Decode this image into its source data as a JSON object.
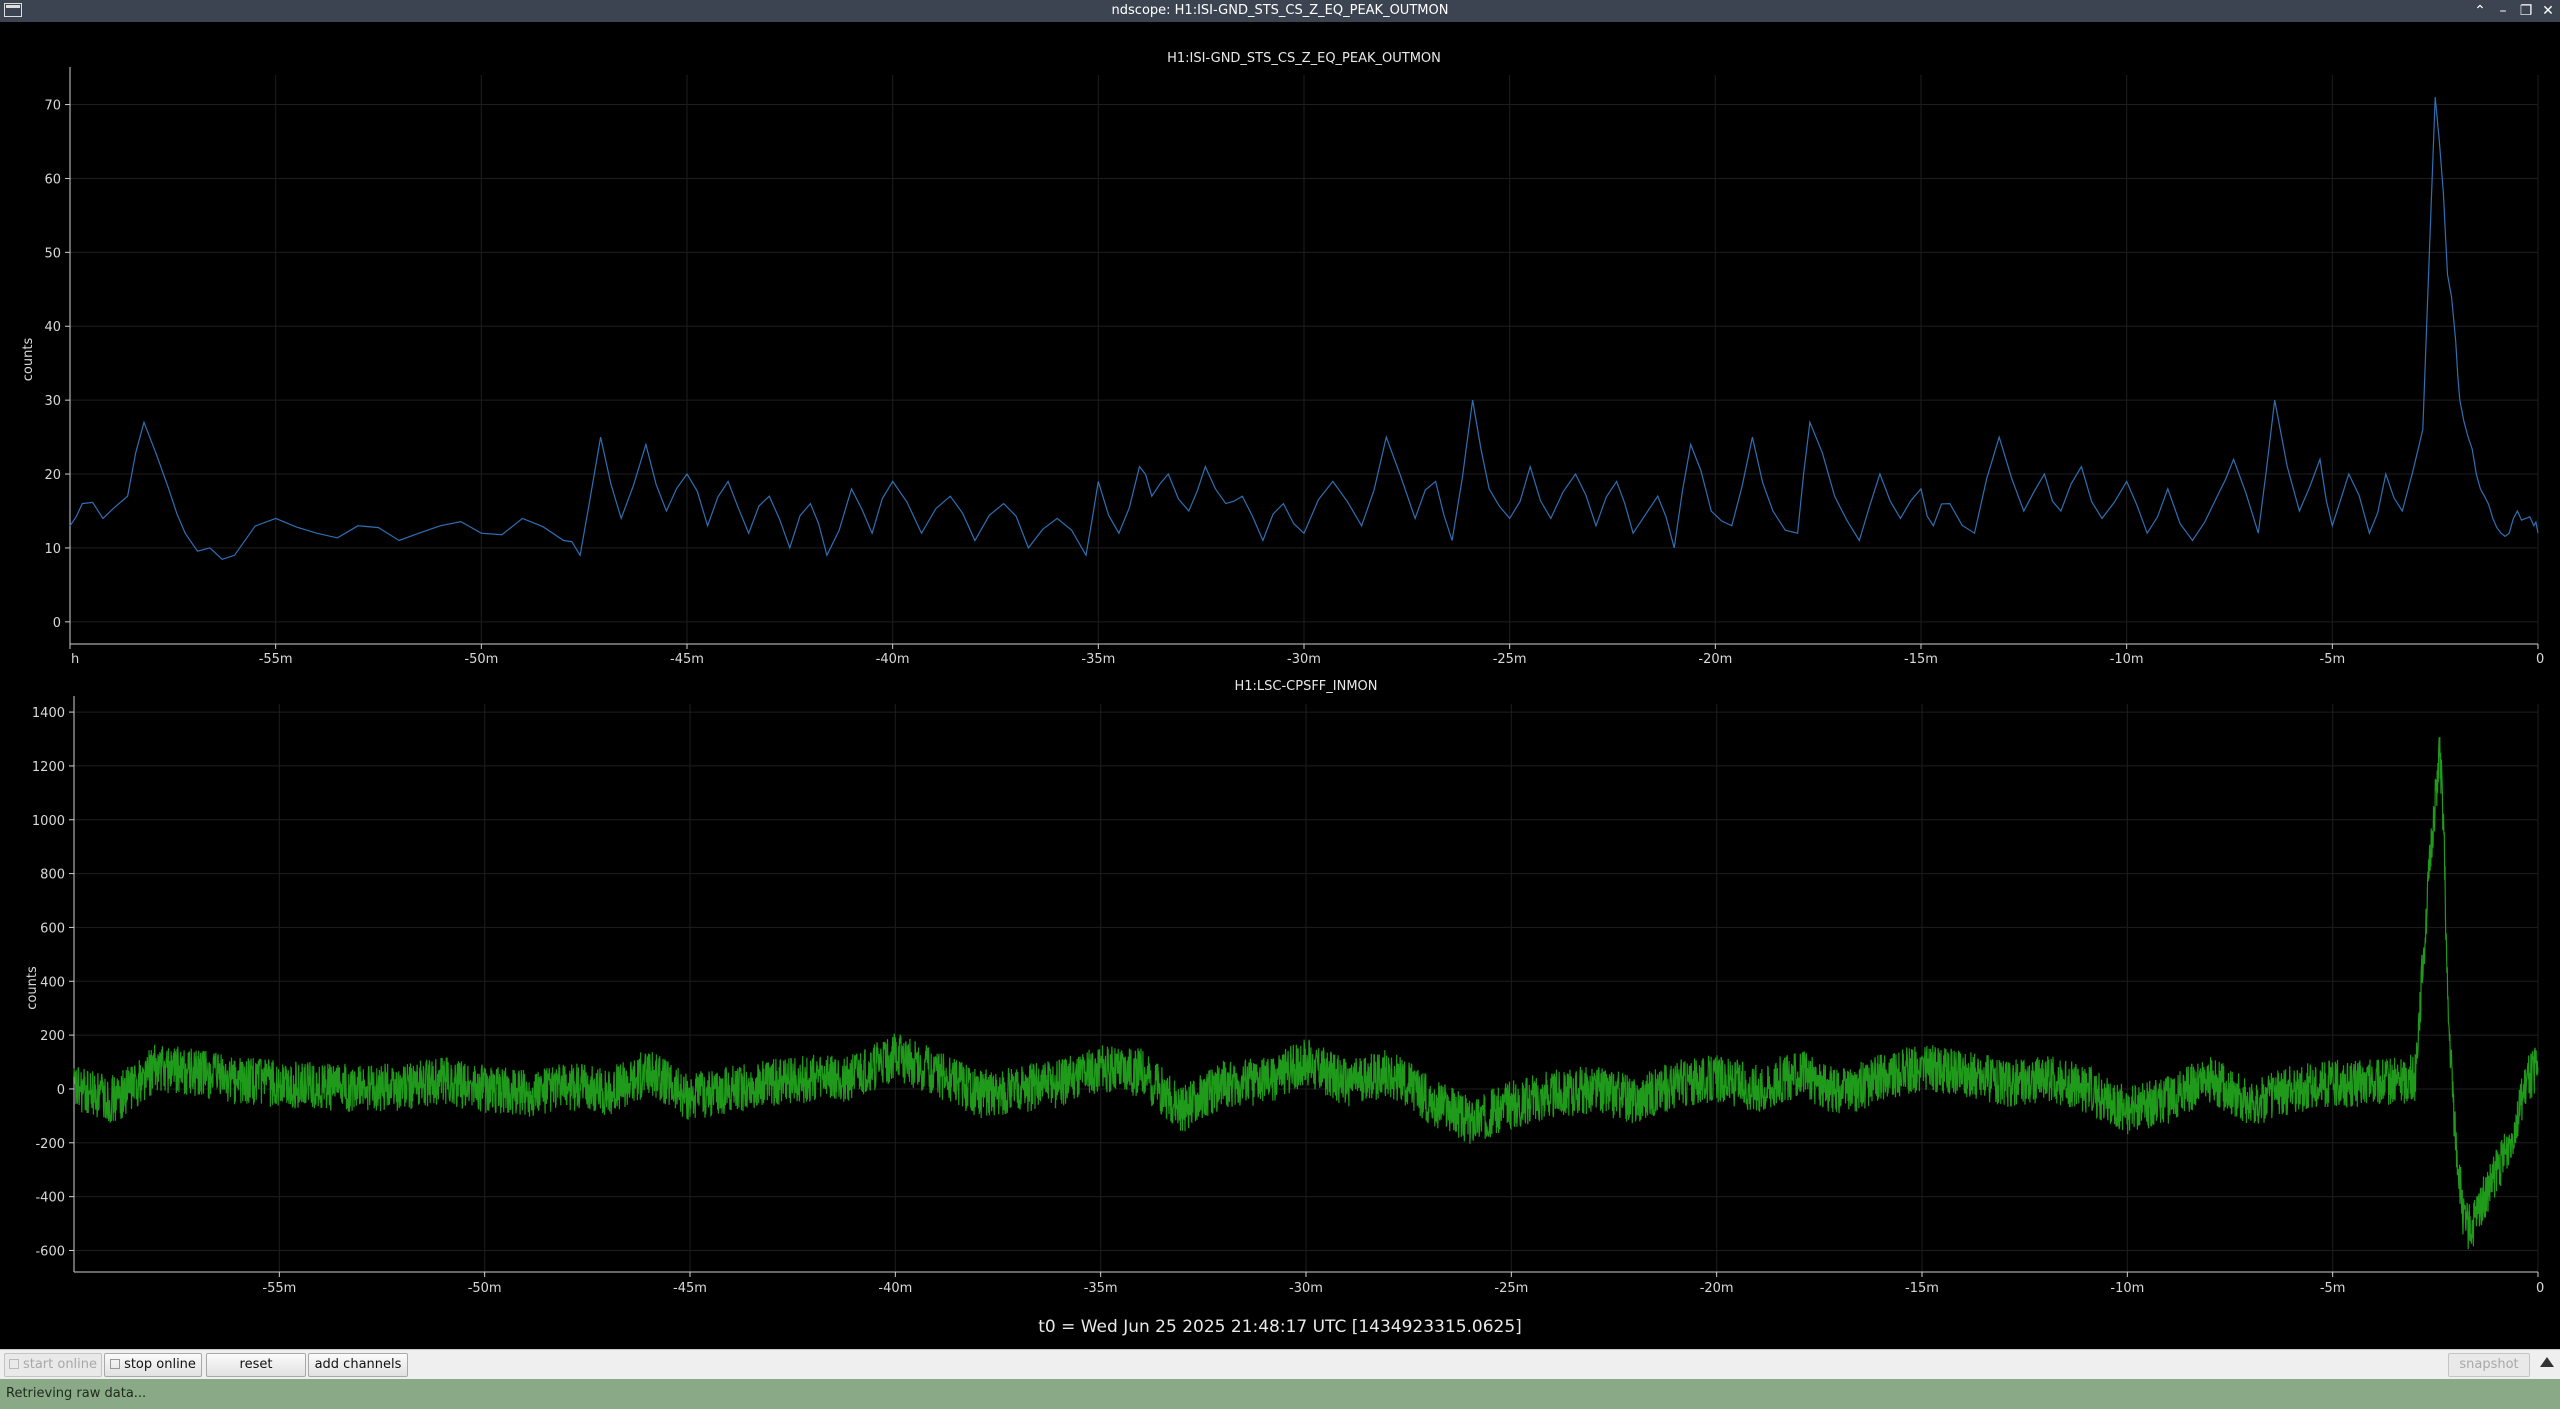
{
  "window": {
    "title": "ndscope: H1:ISI-GND_STS_CS_Z_EQ_PEAK_OUTMON",
    "controls": [
      "minimize-icon",
      "maximize-icon",
      "restore-icon",
      "close-icon"
    ]
  },
  "colors": {
    "background": "#000000",
    "series_top": "#2f6fb3",
    "series_bottom": "#1f9a1a",
    "axis": "#cfcfcf",
    "grid": "#1e1e1e",
    "statusbar": "#8aaa87"
  },
  "chart_data": [
    {
      "type": "line",
      "title": "H1:ISI-GND_STS_CS_Z_EQ_PEAK_OUTMON",
      "xlabel": "",
      "ylabel": "counts",
      "xlim": [
        -60,
        0
      ],
      "ylim": [
        -3,
        74
      ],
      "x_unit": "minutes",
      "grid": true,
      "yticks": [
        0,
        10,
        20,
        30,
        40,
        50,
        60,
        70
      ],
      "xtick_labels": [
        "h",
        "-55m",
        "-50m",
        "-45m",
        "-40m",
        "-35m",
        "-30m",
        "-25m",
        "-20m",
        "-15m",
        "-10m",
        "-5m",
        "0"
      ],
      "series": [
        {
          "color": "#2f6fb3",
          "x": [
            -60,
            -59.7,
            -59.2,
            -58.6,
            -58.2,
            -57.6,
            -57.2,
            -56.6,
            -56.0,
            -55.0,
            -54.0,
            -53.0,
            -52.0,
            -51.0,
            -50.0,
            -49.0,
            -48.0,
            -47.6,
            -47.1,
            -46.6,
            -46.0,
            -45.5,
            -45.0,
            -44.5,
            -44.0,
            -43.5,
            -43.0,
            -42.5,
            -42.0,
            -41.6,
            -41.0,
            -40.5,
            -40.0,
            -39.3,
            -38.6,
            -38.0,
            -37.3,
            -36.7,
            -36.0,
            -35.3,
            -35.0,
            -34.5,
            -34.0,
            -33.7,
            -33.3,
            -32.8,
            -32.4,
            -31.9,
            -31.5,
            -31.0,
            -30.5,
            -30.0,
            -29.3,
            -28.6,
            -28.0,
            -27.3,
            -26.8,
            -26.4,
            -25.9,
            -25.5,
            -25.0,
            -24.5,
            -24.0,
            -23.4,
            -22.9,
            -22.4,
            -22.0,
            -21.4,
            -21.0,
            -20.6,
            -20.1,
            -19.6,
            -19.1,
            -18.6,
            -18.0,
            -17.7,
            -17.1,
            -16.5,
            -16.0,
            -15.5,
            -15.0,
            -14.7,
            -14.3,
            -13.7,
            -13.1,
            -12.5,
            -12.0,
            -11.6,
            -11.1,
            -10.6,
            -10.0,
            -9.5,
            -9.0,
            -8.4,
            -7.8,
            -7.4,
            -6.8,
            -6.4,
            -5.8,
            -5.3,
            -5.0,
            -4.6,
            -4.1,
            -3.7,
            -3.3,
            -2.8,
            -2.5,
            -2.3,
            -2.2,
            -2.0,
            -1.9,
            -1.7,
            -1.5,
            -1.3,
            -1.1,
            -0.9,
            -0.7,
            -0.5,
            -0.3,
            -0.1,
            0
          ],
          "values": [
            13,
            16,
            14,
            17,
            27,
            18,
            12,
            10,
            9,
            14,
            12,
            13,
            11,
            13,
            12,
            14,
            11,
            9,
            25,
            14,
            24,
            15,
            20,
            13,
            19,
            12,
            17,
            10,
            16,
            9,
            18,
            12,
            19,
            12,
            17,
            11,
            16,
            10,
            14,
            9,
            19,
            12,
            21,
            17,
            20,
            15,
            21,
            16,
            17,
            11,
            16,
            12,
            19,
            13,
            25,
            14,
            19,
            11,
            30,
            18,
            14,
            21,
            14,
            20,
            13,
            19,
            12,
            17,
            10,
            24,
            15,
            13,
            25,
            15,
            12,
            27,
            17,
            11,
            20,
            14,
            18,
            13,
            16,
            12,
            25,
            15,
            20,
            15,
            21,
            14,
            19,
            12,
            18,
            11,
            17,
            22,
            12,
            30,
            15,
            22,
            13,
            20,
            12,
            20,
            15,
            26,
            71,
            58,
            47,
            38,
            30,
            25,
            20,
            17,
            14,
            12,
            12,
            15,
            14,
            13,
            12
          ]
        }
      ]
    },
    {
      "type": "line",
      "title": "H1:LSC-CPSFF_INMON",
      "xlabel": "",
      "ylabel": "counts",
      "xlim": [
        -60,
        0
      ],
      "ylim": [
        -680,
        1430
      ],
      "x_unit": "minutes",
      "grid": true,
      "yticks": [
        -600,
        -400,
        -200,
        0,
        200,
        400,
        600,
        800,
        1000,
        1200,
        1400
      ],
      "xtick_labels": [
        "-55m",
        "-50m",
        "-45m",
        "-40m",
        "-35m",
        "-30m",
        "-25m",
        "-20m",
        "-15m",
        "-10m",
        "-5m",
        "0"
      ],
      "series": [
        {
          "color": "#1f9a1a",
          "x": [
            -60,
            -59,
            -58,
            -57,
            -56,
            -55,
            -54,
            -53,
            -52,
            -51,
            -50,
            -49,
            -48,
            -47,
            -46,
            -45,
            -44,
            -43,
            -42,
            -41,
            -40,
            -39,
            -38,
            -37,
            -36,
            -35,
            -34,
            -33,
            -32,
            -31,
            -30,
            -29,
            -28,
            -27,
            -26,
            -25,
            -24,
            -23,
            -22,
            -21,
            -20,
            -19,
            -18,
            -17,
            -16,
            -15,
            -14,
            -13,
            -12,
            -11,
            -10,
            -9,
            -8,
            -7,
            -6,
            -5,
            -4,
            -3,
            -2.6,
            -2.4,
            -2.3,
            -2.2,
            -2.0,
            -1.8,
            -1.6,
            -1.4,
            -1.2,
            -1.0,
            -0.8,
            -0.6,
            -0.4,
            -0.2,
            0
          ],
          "values": [
            0,
            -40,
            80,
            60,
            30,
            20,
            10,
            0,
            10,
            30,
            0,
            -20,
            10,
            -10,
            60,
            -30,
            0,
            20,
            40,
            40,
            120,
            60,
            -20,
            0,
            20,
            80,
            60,
            -80,
            20,
            30,
            100,
            20,
            60,
            -40,
            -120,
            -60,
            -20,
            0,
            -40,
            20,
            40,
            0,
            60,
            -20,
            40,
            80,
            60,
            20,
            40,
            0,
            -80,
            -40,
            40,
            -60,
            0,
            20,
            20,
            40,
            900,
            1250,
            1000,
            300,
            -200,
            -500,
            -520,
            -430,
            -380,
            -300,
            -250,
            -150,
            -50,
            50,
            80
          ],
          "envelope": 90
        }
      ]
    }
  ],
  "footer": {
    "t0_label": "t0 = Wed Jun 25 2025 21:48:17 UTC [1434923315.0625]"
  },
  "toolbar": {
    "start_online_label": "start online",
    "stop_online_label": "stop online",
    "reset_label": "reset",
    "add_channels_label": "add channels",
    "snapshot_label": "snapshot"
  },
  "status": {
    "text": "Retrieving raw data..."
  }
}
